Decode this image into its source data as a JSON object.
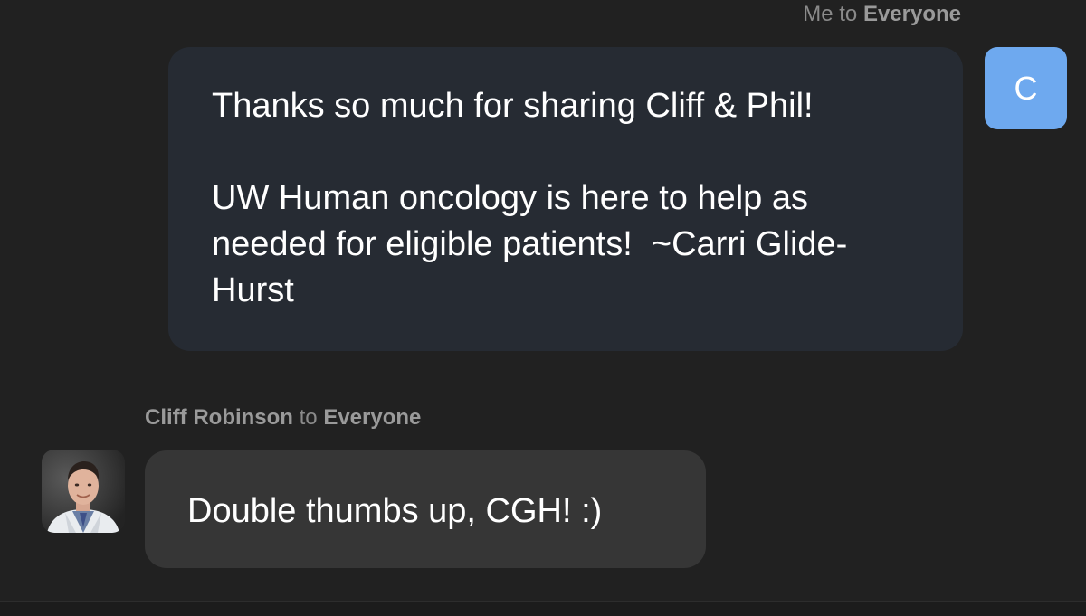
{
  "outgoing": {
    "sender": "Me",
    "connector": "to",
    "recipient": "Everyone",
    "avatar_letter": "C",
    "avatar_color": "#6ea9ef",
    "bubble_color": "#262b33",
    "message": "Thanks so much for sharing Cliff & Phil!\n\nUW Human oncology is here to help as needed for eligible patients!  ~Carri Glide-Hurst"
  },
  "incoming": {
    "sender": "Cliff Robinson",
    "connector": "to",
    "recipient": "Everyone",
    "bubble_color": "#363636",
    "message": "Double thumbs up, CGH! :)"
  },
  "colors": {
    "background": "#212121",
    "meta_text": "#8a8a8a",
    "message_text": "#ffffff"
  }
}
